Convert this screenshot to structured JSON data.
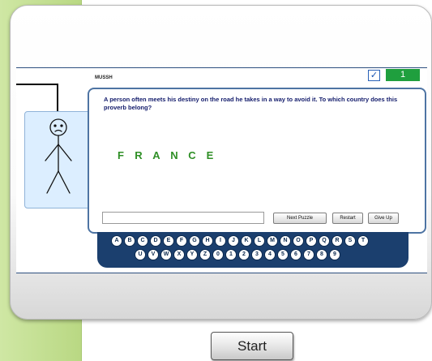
{
  "game": {
    "label": "MUSSH",
    "checkbox_mark": "✓",
    "score": "1",
    "question": "A person often meets his destiny on the road he takes in a way to avoid it. To which country does this proverb belong?",
    "answer_letters": [
      "F",
      "R",
      "A",
      "N",
      "C",
      "E"
    ],
    "answer_input_value": "",
    "buttons": {
      "next_puzzle": "Next Puzzle",
      "restart": "Restart",
      "give_up": "Give Up"
    },
    "keyboard_row1": [
      "A",
      "B",
      "C",
      "D",
      "E",
      "F",
      "G",
      "H",
      "I",
      "J",
      "K",
      "L",
      "M",
      "N",
      "O",
      "P",
      "Q",
      "R",
      "S",
      "T"
    ],
    "keyboard_row2": [
      "U",
      "V",
      "W",
      "X",
      "Y",
      "Z",
      "0",
      "1",
      "2",
      "3",
      "4",
      "5",
      "6",
      "7",
      "8",
      "9"
    ]
  },
  "start_button": "Start",
  "colors": {
    "accent_blue": "#1b3f6e",
    "score_green": "#1f9f3e",
    "answer_green": "#2f8f26",
    "side_tab_green": "#c2df90"
  },
  "icons": {
    "hangman": "stick-figure-icon",
    "checkbox": "checkmark-icon"
  }
}
